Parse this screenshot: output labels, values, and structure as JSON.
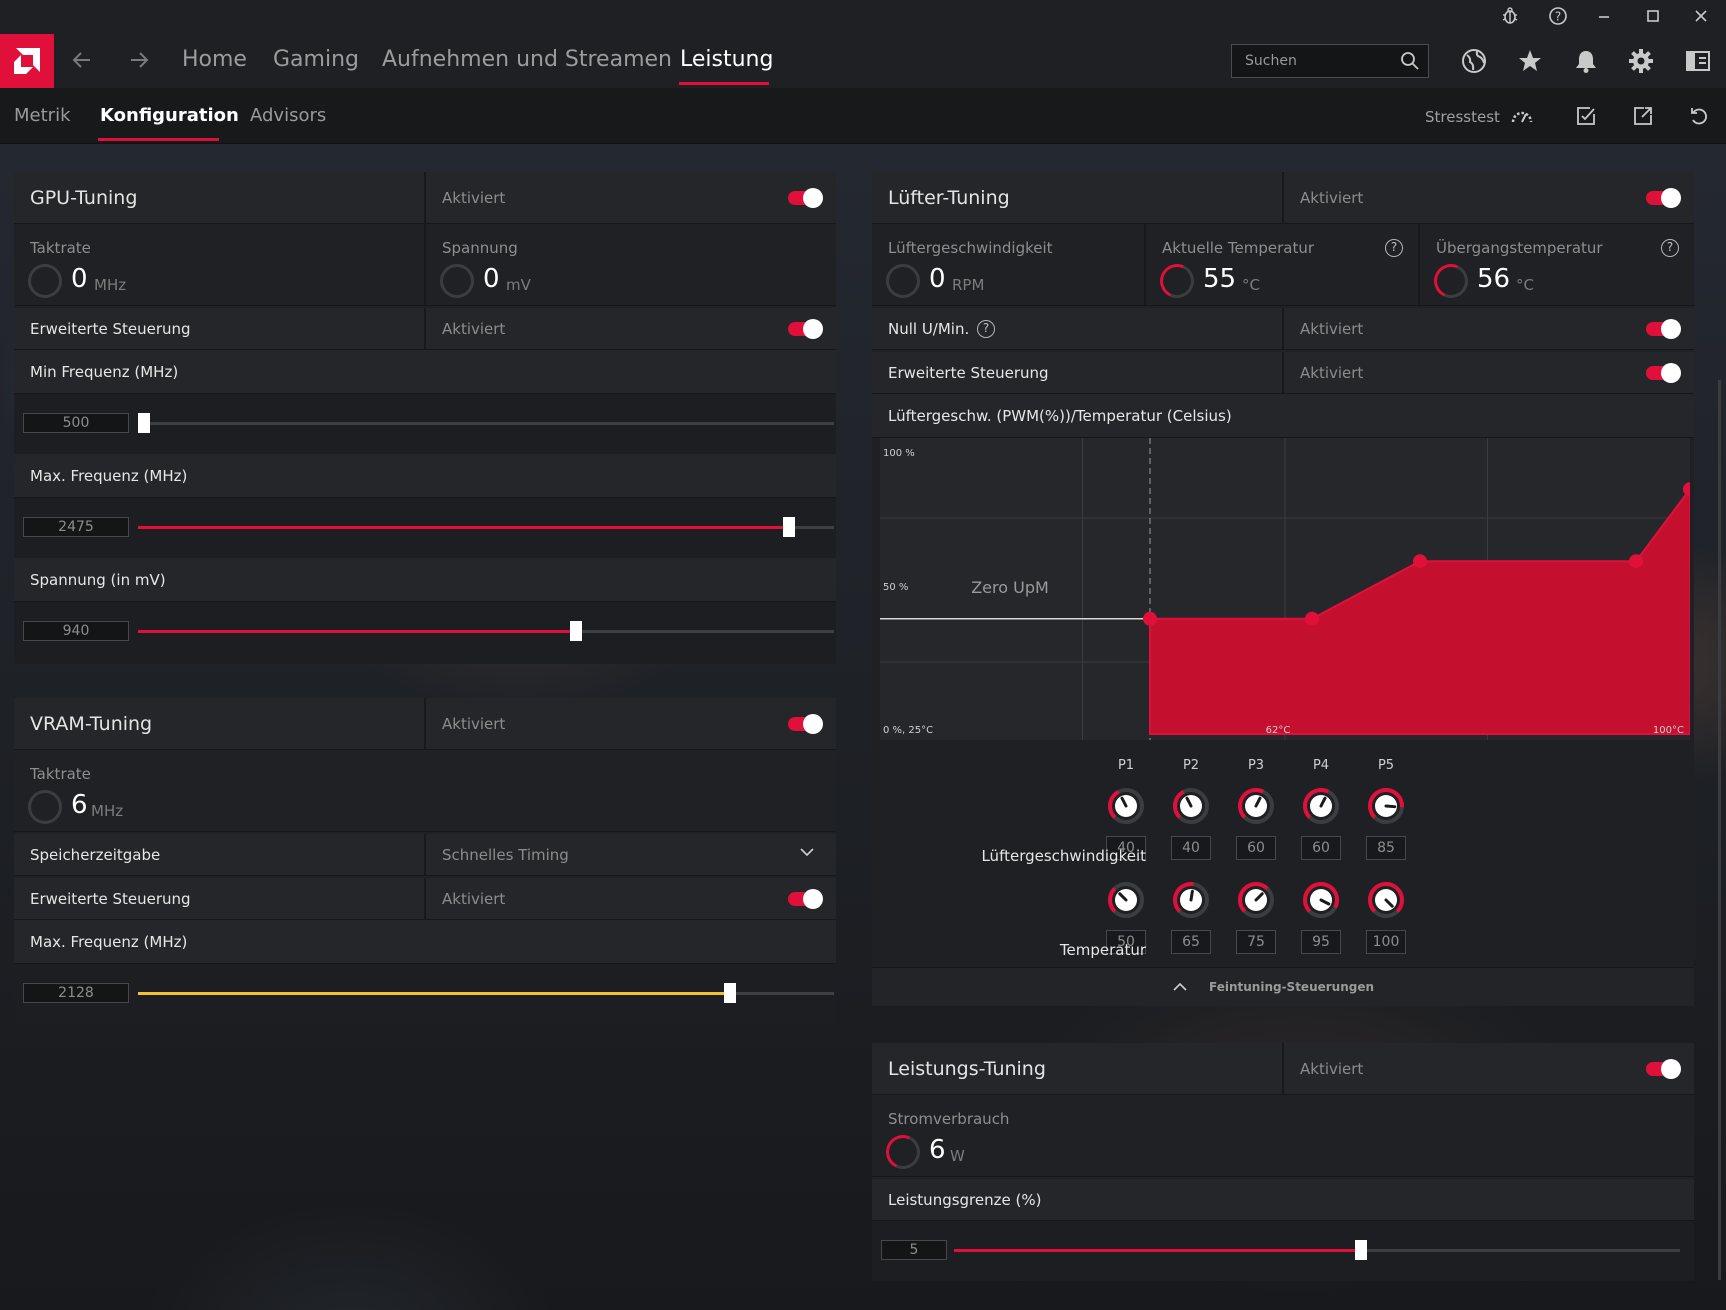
{
  "nav": {
    "items": [
      "Home",
      "Gaming",
      "Aufnehmen und Streamen",
      "Leistung"
    ],
    "active": "Leistung",
    "search_placeholder": "Suchen"
  },
  "subnav": {
    "tabs": [
      "Metrik",
      "Konfiguration",
      "Advisors"
    ],
    "active": "Konfiguration",
    "stress_label": "Stresstest"
  },
  "colors": {
    "accent": "#e0103a",
    "vram_slider": "#f2c12e"
  },
  "gpu": {
    "title": "GPU-Tuning",
    "status": "Aktiviert",
    "clock_label": "Taktrate",
    "clock_value": "0",
    "clock_unit": "MHz",
    "voltage_label": "Spannung",
    "voltage_value": "0",
    "voltage_unit": "mV",
    "advanced_label": "Erweiterte Steuerung",
    "advanced_status": "Aktiviert",
    "min_freq_label": "Min Frequenz (MHz)",
    "min_freq_value": "500",
    "min_freq_fraction": 0.0,
    "max_freq_label": "Max. Frequenz (MHz)",
    "max_freq_value": "2475",
    "max_freq_fraction": 0.935,
    "volt_label": "Spannung (in mV)",
    "volt_value": "940",
    "volt_fraction": 0.63
  },
  "vram": {
    "title": "VRAM-Tuning",
    "status": "Aktiviert",
    "clock_label": "Taktrate",
    "clock_value": "6",
    "clock_unit": "MHz",
    "timing_label": "Speicherzeitgabe",
    "timing_value": "Schnelles Timing",
    "advanced_label": "Erweiterte Steuerung",
    "advanced_status": "Aktiviert",
    "max_freq_label": "Max. Frequenz (MHz)",
    "max_freq_value": "2128",
    "max_freq_fraction": 0.85
  },
  "fan": {
    "title": "Lüfter-Tuning",
    "status": "Aktiviert",
    "speed_label": "Lüftergeschwindigkeit",
    "speed_value": "0",
    "speed_unit": "RPM",
    "temp_label": "Aktuelle Temperatur",
    "temp_value": "55",
    "temp_unit": "°C",
    "junction_label": "Übergangstemperatur",
    "junction_value": "56",
    "junction_unit": "°C",
    "zero_rpm_label": "Null U/Min.",
    "zero_rpm_status": "Aktiviert",
    "advanced_label": "Erweiterte Steuerung",
    "advanced_status": "Aktiviert",
    "curve_label": "Lüftergeschw. (PWM(%))/Temperatur (Celsius)",
    "knob_speed_label": "Lüftergeschwindigkeit",
    "knob_temp_label": "Temperatur",
    "fine_tuning_label": "Feintuning-Steuerungen"
  },
  "chart_data": {
    "type": "area",
    "y_tick_labels": [
      "100 %",
      "50 %",
      "0 %, 25°C"
    ],
    "x_tick_labels": [
      "62°C",
      "100°C"
    ],
    "zero_label": "Zero UpM",
    "xlim": [
      25,
      100
    ],
    "ylim": [
      0,
      100
    ],
    "zero_rpm_until": 50,
    "points": [
      {
        "name": "P1",
        "speed": 40,
        "temp": 50
      },
      {
        "name": "P2",
        "speed": 40,
        "temp": 65
      },
      {
        "name": "P3",
        "speed": 60,
        "temp": 75
      },
      {
        "name": "P4",
        "speed": 60,
        "temp": 95
      },
      {
        "name": "P5",
        "speed": 85,
        "temp": 100
      }
    ]
  },
  "power": {
    "title": "Leistungs-Tuning",
    "status": "Aktiviert",
    "consumption_label": "Stromverbrauch",
    "consumption_value": "6",
    "consumption_unit": "W",
    "limit_label": "Leistungsgrenze (%)",
    "limit_value": "5",
    "limit_fraction": 0.56
  }
}
